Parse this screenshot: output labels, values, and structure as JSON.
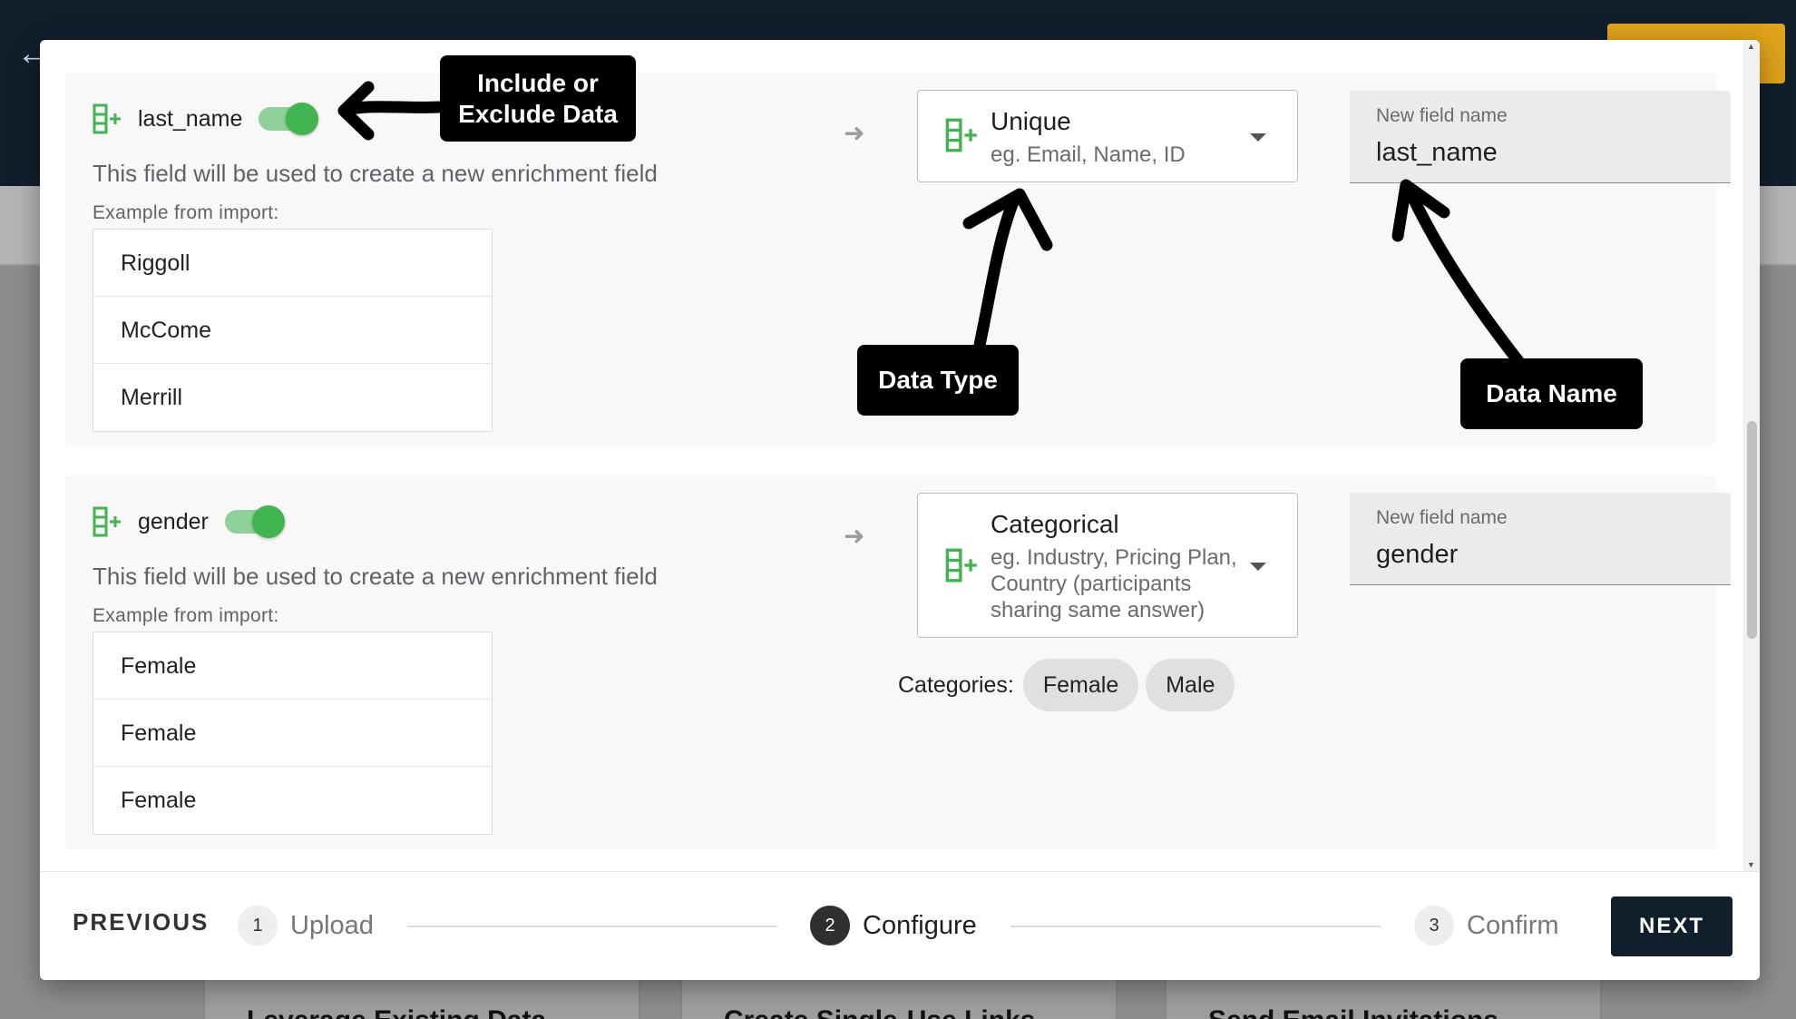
{
  "background": {
    "cards": [
      "Leverage Existing Data",
      "Create Single-Use Links",
      "Send Email Invitations"
    ]
  },
  "fields": [
    {
      "name": "last_name",
      "description": "This field will be used to create a new enrichment field",
      "example_label": "Example from import:",
      "examples": [
        "Riggoll",
        "McCome",
        "Merrill"
      ],
      "type": {
        "name": "Unique",
        "hint": "eg. Email, Name, ID"
      },
      "new_field": {
        "label": "New field name",
        "value": "last_name"
      }
    },
    {
      "name": "gender",
      "description": "This field will be used to create a new enrichment field",
      "example_label": "Example from import:",
      "examples": [
        "Female",
        "Female",
        "Female"
      ],
      "type": {
        "name": "Categorical",
        "hint": "eg. Industry, Pricing Plan, Country (participants sharing same answer)"
      },
      "new_field": {
        "label": "New field name",
        "value": "gender"
      },
      "categories_label": "Categories:",
      "categories": [
        "Female",
        "Male"
      ]
    }
  ],
  "annotations": {
    "include": "Include or Exclude Data",
    "data_type": "Data Type",
    "data_name": "Data Name"
  },
  "footer": {
    "previous": "PREVIOUS",
    "steps": [
      {
        "num": "1",
        "label": "Upload"
      },
      {
        "num": "2",
        "label": "Configure"
      },
      {
        "num": "3",
        "label": "Confirm"
      }
    ],
    "next": "NEXT"
  },
  "colors": {
    "accent_green": "#3fb44f",
    "dark": "#0f1f2c",
    "annotation": "#000000"
  }
}
